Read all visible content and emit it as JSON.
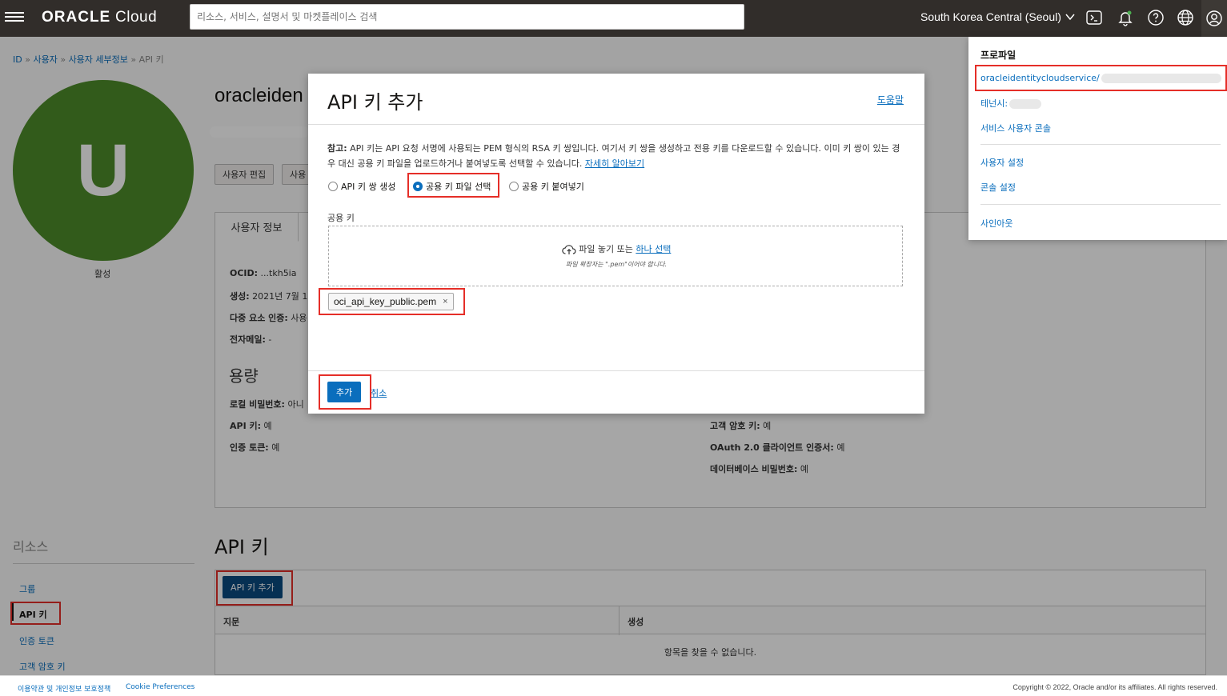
{
  "topbar": {
    "logo_bold": "ORACLE",
    "logo_rest": " Cloud",
    "search_placeholder": "리소스, 서비스, 설명서 및 마켓플레이스 검색",
    "region": "South Korea Central (Seoul)"
  },
  "page": {
    "breadcrumb": [
      "ID",
      "사용자",
      "사용자 세부정보",
      "API 키"
    ],
    "breadcrumb_sep": "»",
    "avatar_letter": "U",
    "status": "활성",
    "user_title": "oracleiden",
    "buttons": [
      "사용자 편집",
      "사용"
    ],
    "info_tab": "사용자 정보",
    "info": {
      "ocid_label": "OCID:",
      "ocid_value": " ...tkh5ia",
      "created_label": "생성:",
      "created_value": " 2021년 7월 1",
      "mfa_label": "다중 요소 인증:",
      "mfa_value": " 사용",
      "email_label": "전자메일:",
      "email_value": " -"
    },
    "capability_title": "용량",
    "capabilities_left": [
      {
        "label": "로컬 비밀번호:",
        "value": " 아니"
      },
      {
        "label": "API 키:",
        "value": " 예"
      },
      {
        "label": "인증 토큰:",
        "value": " 예"
      }
    ],
    "capabilities_right": [
      {
        "label": "고객 암호 키:",
        "value": " 예"
      },
      {
        "label": "OAuth 2.0 클라이언트 인증서:",
        "value": " 예"
      },
      {
        "label": "데이터베이스 비밀번호:",
        "value": " 예"
      }
    ],
    "resources_title": "리소스",
    "resources": [
      "그룹",
      "API 키",
      "인증 토큰",
      "고객 암호 키"
    ],
    "apikey_title": "API 키",
    "add_apikey_button": "API 키 추가",
    "table_headers": [
      "지문",
      "생성"
    ],
    "table_empty": "항목을 찾을 수 없습니다."
  },
  "dialog": {
    "title": "API 키 추가",
    "help": "도움말",
    "note_bold": "참고:",
    "note_text": " API 키는 API 요청 서명에 사용되는 PEM 형식의 RSA 키 쌍입니다. 여기서 키 쌍을 생성하고 전용 키를 다운로드할 수 있습니다. 이미 키 쌍이 있는 경우 대신 공용 키 파일을 업로드하거나 붙여넣도록 선택할 수 있습니다. ",
    "note_link": "자세히 알아보기",
    "radios": [
      "API 키 쌍 생성",
      "공용 키 파일 선택",
      "공용 키 붙여넣기"
    ],
    "selected_radio": "공용 키 파일 선택",
    "field_label": "공용 키",
    "drop_text": "파일 놓기 또는 ",
    "drop_link": "하나 선택",
    "drop_hint": "파일 확장자는 \".pem\"이어야 합니다.",
    "file_name": "oci_api_key_public.pem",
    "file_remove": "×",
    "add_button": "추가",
    "cancel_link": "취소"
  },
  "profile_menu": {
    "title": "프로파일",
    "user": "oracleidentitycloudservice/",
    "tenancy_label": "테넌시:",
    "service_console": "서비스 사용자 콘솔",
    "user_settings": "사용자 설정",
    "console_settings": "콘솔 설정",
    "sign_out": "사인아웃"
  },
  "footer": {
    "terms": "이용약관 및 개인정보 보호정책",
    "cookie": "Cookie Preferences",
    "copyright": "Copyright © 2022, Oracle and/or its affiliates. All rights reserved."
  },
  "colors": {
    "accent": "#0a6ebd",
    "highlight": "#e52e28",
    "avatar": "#4d8c2a",
    "topbar": "#312d2a"
  }
}
